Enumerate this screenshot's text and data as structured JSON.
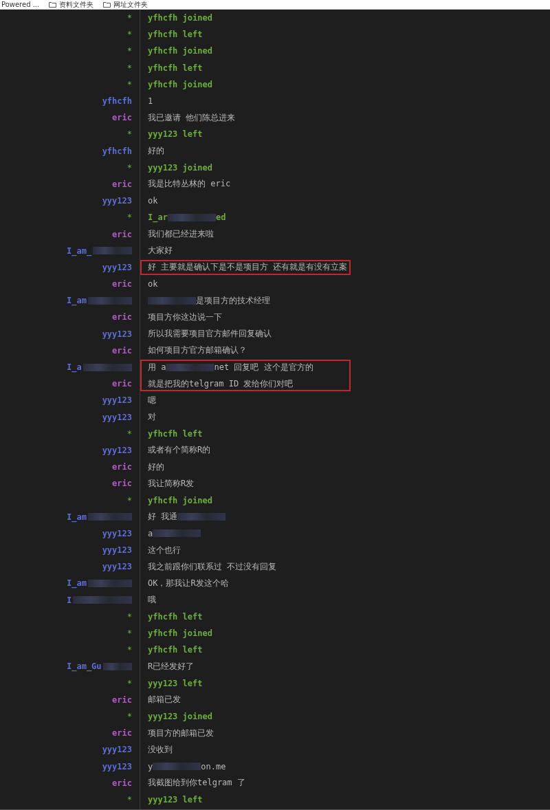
{
  "bookmark_bar": {
    "items": [
      {
        "kind": "link",
        "label": "Powered ..."
      },
      {
        "kind": "folder",
        "label": "资料文件夹"
      },
      {
        "kind": "folder",
        "label": "网址文件夹"
      }
    ]
  },
  "rows": [
    {
      "kind": "event",
      "marker": "*",
      "text": "yfhcfh joined"
    },
    {
      "kind": "event",
      "marker": "*",
      "text": "yfhcfh left"
    },
    {
      "kind": "event",
      "marker": "*",
      "text": "yfhcfh joined"
    },
    {
      "kind": "event",
      "marker": "*",
      "text": "yfhcfh left"
    },
    {
      "kind": "event",
      "marker": "*",
      "text": "yfhcfh joined"
    },
    {
      "kind": "message",
      "nick": "yfhcfh",
      "color": "#5b6fd4",
      "text": "1"
    },
    {
      "kind": "message",
      "nick": "eric",
      "color": "#b05cc4",
      "text": "我已邀请 他们陈总进来"
    },
    {
      "kind": "event",
      "marker": "*",
      "text": "yyy123 left"
    },
    {
      "kind": "message",
      "nick": "yfhcfh",
      "color": "#5b6fd4",
      "text": "好的"
    },
    {
      "kind": "event",
      "marker": "*",
      "text": "yyy123 joined"
    },
    {
      "kind": "message",
      "nick": "eric",
      "color": "#b05cc4",
      "text": "我是比特丛林的 eric"
    },
    {
      "kind": "message",
      "nick": "yyy123",
      "color": "#5b6fd4",
      "text": "ok"
    },
    {
      "kind": "event",
      "marker": "*",
      "segments": [
        {
          "kind": "text",
          "text": "I_ar"
        },
        {
          "kind": "redacted"
        },
        {
          "kind": "text",
          "text": "ed"
        }
      ]
    },
    {
      "kind": "message",
      "nick": "eric",
      "color": "#b05cc4",
      "text": "我们都已经进来啦"
    },
    {
      "kind": "message",
      "nick": "I_am_",
      "nick_redacted": true,
      "color": "#5b6fd4",
      "text": "大家好"
    },
    {
      "kind": "message",
      "nick": "yyy123",
      "color": "#5b6fd4",
      "text": "好 主要就是确认下是不是项目方 还有就是有没有立案",
      "highlighted": true
    },
    {
      "kind": "message",
      "nick": "eric",
      "color": "#b05cc4",
      "text": "ok"
    },
    {
      "kind": "message",
      "nick": "I_am",
      "nick_redacted": true,
      "color": "#5b6fd4",
      "segments": [
        {
          "kind": "redacted"
        },
        {
          "kind": "text",
          "text": "是项目方的技术经理"
        }
      ]
    },
    {
      "kind": "message",
      "nick": "eric",
      "color": "#b05cc4",
      "text": "项目方你这边说一下"
    },
    {
      "kind": "message",
      "nick": "yyy123",
      "color": "#5b6fd4",
      "text": "所以我需要项目官方邮件回复确认"
    },
    {
      "kind": "message",
      "nick": "eric",
      "color": "#b05cc4",
      "text": "如何项目方官方邮箱确认？"
    },
    {
      "kind": "message",
      "nick": "I_a",
      "nick_redacted": true,
      "color": "#5b6fd4",
      "segments": [
        {
          "kind": "text",
          "text": "用 a"
        },
        {
          "kind": "redacted"
        },
        {
          "kind": "text",
          "text": "net 回复吧 这个是官方的"
        }
      ],
      "highlighted": true
    },
    {
      "kind": "message",
      "nick": "eric",
      "color": "#b05cc4",
      "text": "就是把我的telgram ID 发给你们对吧",
      "highlighted": true
    },
    {
      "kind": "message",
      "nick": "yyy123",
      "color": "#5b6fd4",
      "text": "嗯"
    },
    {
      "kind": "message",
      "nick": "yyy123",
      "color": "#5b6fd4",
      "text": "对"
    },
    {
      "kind": "event",
      "marker": "*",
      "text": "yfhcfh left"
    },
    {
      "kind": "message",
      "nick": "yyy123",
      "color": "#5b6fd4",
      "text": "或者有个简称R的"
    },
    {
      "kind": "message",
      "nick": "eric",
      "color": "#b05cc4",
      "text": "好的"
    },
    {
      "kind": "message",
      "nick": "eric",
      "color": "#b05cc4",
      "text": "我让简称R发"
    },
    {
      "kind": "event",
      "marker": "*",
      "text": "yfhcfh joined"
    },
    {
      "kind": "message",
      "nick": "I_am",
      "nick_redacted": true,
      "color": "#5b6fd4",
      "segments": [
        {
          "kind": "text",
          "text": "好 我通"
        },
        {
          "kind": "redacted"
        }
      ]
    },
    {
      "kind": "message",
      "nick": "yyy123",
      "color": "#5b6fd4",
      "segments": [
        {
          "kind": "text",
          "text": "a"
        },
        {
          "kind": "redacted"
        }
      ]
    },
    {
      "kind": "message",
      "nick": "yyy123",
      "color": "#5b6fd4",
      "text": "这个也行"
    },
    {
      "kind": "message",
      "nick": "yyy123",
      "color": "#5b6fd4",
      "text": "我之前跟你们联系过 不过没有回复"
    },
    {
      "kind": "message",
      "nick": "I_am",
      "nick_redacted": true,
      "color": "#5b6fd4",
      "text": "OK，那我让R发这个哈"
    },
    {
      "kind": "message",
      "nick": "I",
      "nick_redacted": true,
      "color": "#5b6fd4",
      "text": "哦"
    },
    {
      "kind": "event",
      "marker": "*",
      "text": "yfhcfh left"
    },
    {
      "kind": "event",
      "marker": "*",
      "text": "yfhcfh joined"
    },
    {
      "kind": "event",
      "marker": "*",
      "text": "yfhcfh left"
    },
    {
      "kind": "message",
      "nick": "I_am_Gu",
      "nick_redacted": true,
      "color": "#5b6fd4",
      "text": "R已经发好了"
    },
    {
      "kind": "event",
      "marker": "*",
      "text": "yyy123 left"
    },
    {
      "kind": "message",
      "nick": "eric",
      "color": "#b05cc4",
      "text": "邮箱已发"
    },
    {
      "kind": "event",
      "marker": "*",
      "text": "yyy123 joined"
    },
    {
      "kind": "message",
      "nick": "eric",
      "color": "#b05cc4",
      "text": "项目方的邮箱已发"
    },
    {
      "kind": "message",
      "nick": "yyy123",
      "color": "#5b6fd4",
      "text": "没收到"
    },
    {
      "kind": "message",
      "nick": "yyy123",
      "color": "#5b6fd4",
      "segments": [
        {
          "kind": "text",
          "text": "y"
        },
        {
          "kind": "redacted"
        },
        {
          "kind": "text",
          "text": "on.me"
        }
      ]
    },
    {
      "kind": "message",
      "nick": "eric",
      "color": "#b05cc4",
      "text": "我截图给到你telgram 了"
    },
    {
      "kind": "event",
      "marker": "*",
      "text": "yyy123 left"
    }
  ]
}
